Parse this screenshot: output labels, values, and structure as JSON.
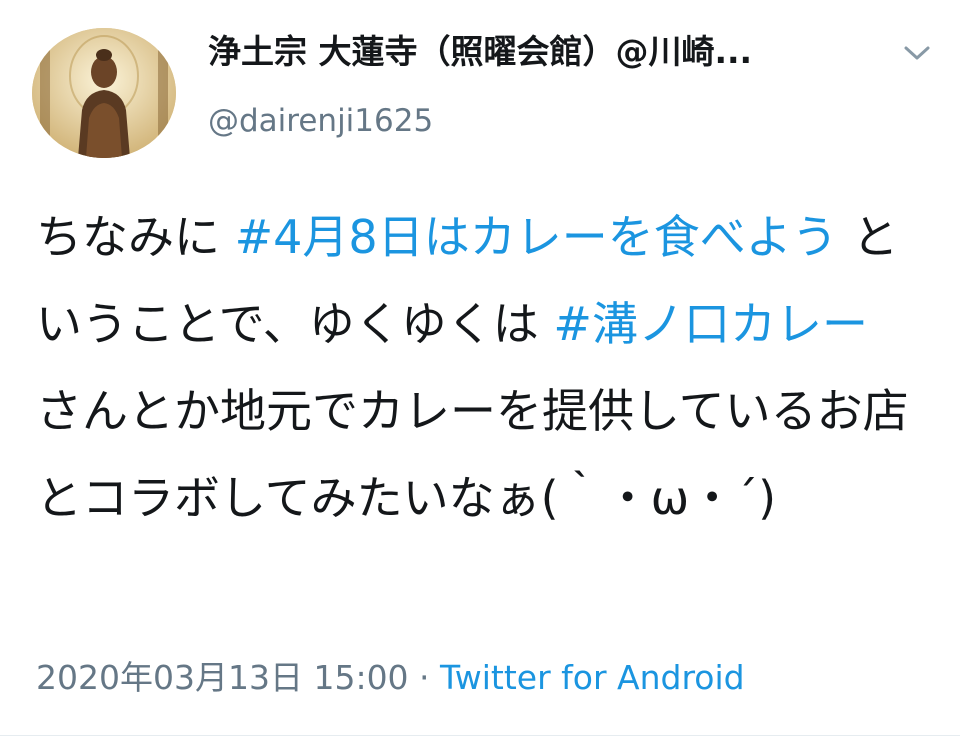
{
  "user": {
    "display_name": "浄土宗 大蓮寺（照曜会館）@川崎...",
    "handle": "@dairenji1625",
    "avatar_icon": "buddha-statue-avatar"
  },
  "menu": {
    "icon": "chevron-down-icon"
  },
  "tweet": {
    "segments": [
      {
        "text": "ちなみに ",
        "type": "text"
      },
      {
        "text": "#4月8日はカレーを食べよう",
        "type": "hashtag"
      },
      {
        "text": " ということで、ゆくゆくは ",
        "type": "text"
      },
      {
        "text": "#溝ノ口カレー",
        "type": "hashtag"
      },
      {
        "text": " さんとか地元でカレーを提供しているお店とコラボしてみたいなぁ(｀・ω・´)",
        "type": "text"
      }
    ]
  },
  "meta": {
    "timestamp": "2020年03月13日 15:00",
    "separator": " · ",
    "source": "Twitter for Android"
  },
  "colors": {
    "text": "#14171a",
    "secondary": "#657786",
    "link": "#1b95e0",
    "divider": "#e6ecf0"
  }
}
